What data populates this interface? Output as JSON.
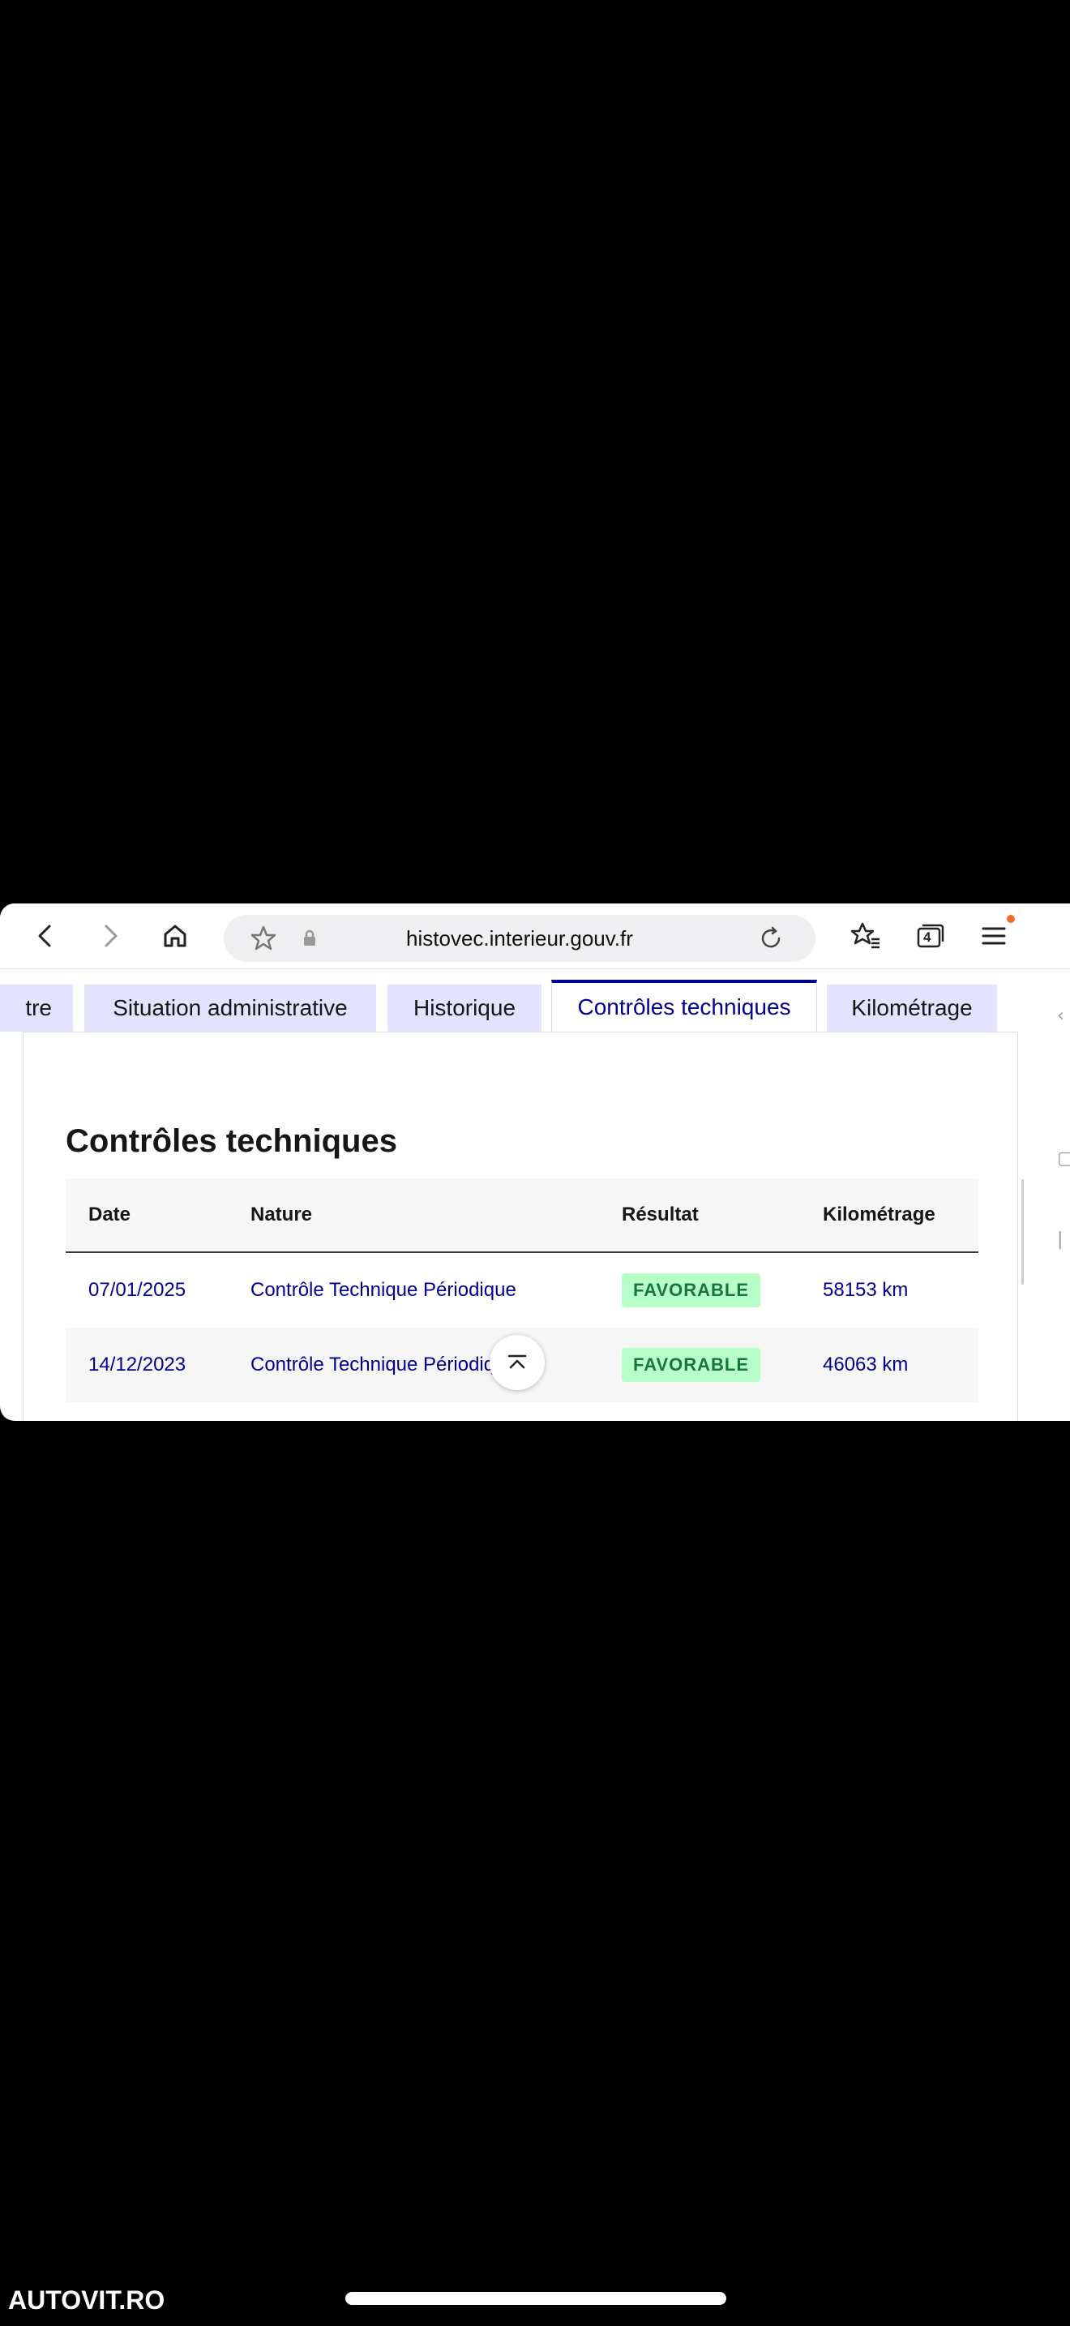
{
  "browser": {
    "url": "histovec.interieur.gouv.fr",
    "tabs_count": "4"
  },
  "tabs": [
    {
      "label": "tre"
    },
    {
      "label": "Situation administrative"
    },
    {
      "label": "Historique"
    },
    {
      "label": "Contrôles techniques",
      "active": true
    },
    {
      "label": "Kilométrage"
    }
  ],
  "section": {
    "title": "Contrôles techniques",
    "columns": [
      "Date",
      "Nature",
      "Résultat",
      "Kilométrage"
    ],
    "rows": [
      {
        "date": "07/01/2025",
        "nature": "Contrôle Technique Périodique",
        "result": "FAVORABLE",
        "km": "58153 km"
      },
      {
        "date": "14/12/2023",
        "nature": "Contrôle Technique Périodique",
        "result": "FAVORABLE",
        "km": "46063 km"
      }
    ]
  },
  "footer": {
    "logo": "AUTOVIT.RO"
  },
  "colors": {
    "primary": "#000091",
    "tab_bg": "#e3e3fd",
    "success_bg": "#b8fec9",
    "success_text": "#18753c",
    "notification": "#f06a28"
  }
}
